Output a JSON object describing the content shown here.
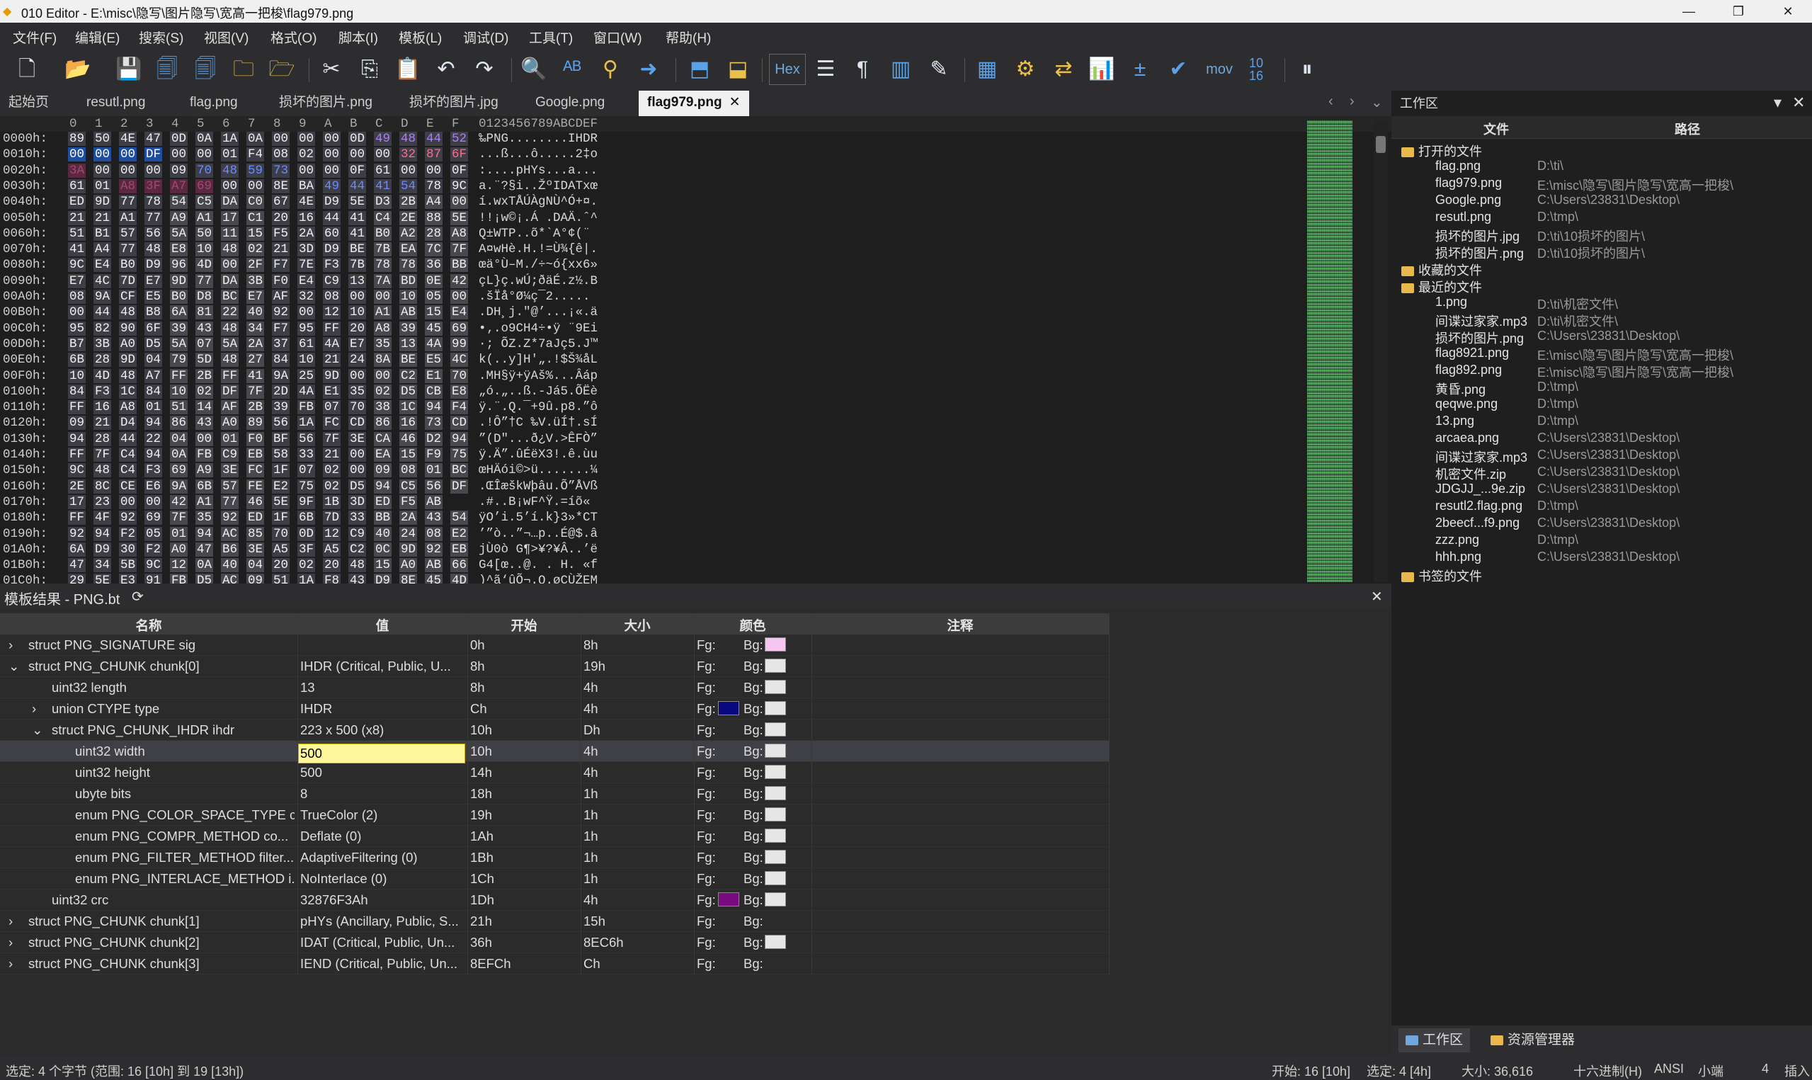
{
  "window": {
    "title": "010 Editor - E:\\misc\\隐写\\图片隐写\\宽高一把梭\\flag979.png"
  },
  "menu": [
    "文件(F)",
    "编辑(E)",
    "搜索(S)",
    "视图(V)",
    "格式(O)",
    "脚本(I)",
    "模板(L)",
    "调试(D)",
    "工具(T)",
    "窗口(W)",
    "帮助(H)"
  ],
  "toolbar": {
    "hex_label": "Hex",
    "mov_label": "mov",
    "num_label": "10 16"
  },
  "tabs": [
    {
      "label": "起始页"
    },
    {
      "label": "resutl.png"
    },
    {
      "label": "flag.png"
    },
    {
      "label": "损坏的图片.png"
    },
    {
      "label": "损坏的图片.jpg"
    },
    {
      "label": "Google.png"
    },
    {
      "label": "flag979.png",
      "active": true
    }
  ],
  "hex": {
    "col_header": [
      "0",
      "1",
      "2",
      "3",
      "4",
      "5",
      "6",
      "7",
      "8",
      "9",
      "A",
      "B",
      "C",
      "D",
      "E",
      "F"
    ],
    "ascii_header": "0123456789ABCDEF",
    "rows": [
      {
        "addr": "0000h:",
        "bytes": [
          "89",
          "50",
          "4E",
          "47",
          "0D",
          "0A",
          "1A",
          "0A",
          "00",
          "00",
          "00",
          "0D",
          "49",
          "48",
          "44",
          "52"
        ],
        "ascii": "‰PNG........IHDR"
      },
      {
        "addr": "0010h:",
        "bytes": [
          "00",
          "00",
          "00",
          "DF",
          "00",
          "00",
          "01",
          "F4",
          "08",
          "02",
          "00",
          "00",
          "00",
          "32",
          "87",
          "6F"
        ],
        "ascii": "...ß...ô.....2‡o"
      },
      {
        "addr": "0020h:",
        "bytes": [
          "3A",
          "00",
          "00",
          "00",
          "09",
          "70",
          "48",
          "59",
          "73",
          "00",
          "00",
          "0F",
          "61",
          "00",
          "00",
          "0F"
        ],
        "ascii": ":....pHYs...a..."
      },
      {
        "addr": "0030h:",
        "bytes": [
          "61",
          "01",
          "A8",
          "3F",
          "A7",
          "69",
          "00",
          "00",
          "8E",
          "BA",
          "49",
          "44",
          "41",
          "54",
          "78",
          "9C"
        ],
        "ascii": "a.¨?§i..ŽºIDATxœ"
      },
      {
        "addr": "0040h:",
        "bytes": [
          "ED",
          "9D",
          "77",
          "78",
          "54",
          "C5",
          "DA",
          "C0",
          "67",
          "4E",
          "D9",
          "5E",
          "D3",
          "2B",
          "A4",
          "00"
        ],
        "ascii": "í.wxTÅÚÀgNÙ^Ó+¤."
      },
      {
        "addr": "0050h:",
        "bytes": [
          "21",
          "21",
          "A1",
          "77",
          "A9",
          "A1",
          "17",
          "C1",
          "20",
          "16",
          "44",
          "41",
          "C4",
          "2E",
          "88",
          "5E"
        ],
        "ascii": "!!¡w©¡.Á .DAÄ.ˆ^"
      },
      {
        "addr": "0060h:",
        "bytes": [
          "51",
          "B1",
          "57",
          "56",
          "5A",
          "50",
          "11",
          "15",
          "F5",
          "2A",
          "60",
          "41",
          "B0",
          "A2",
          "28",
          "A8"
        ],
        "ascii": "Q±WTP..õ*`A°¢(¨"
      },
      {
        "addr": "0070h:",
        "bytes": [
          "41",
          "A4",
          "77",
          "48",
          "E8",
          "10",
          "48",
          "02",
          "21",
          "3D",
          "D9",
          "BE",
          "7B",
          "EA",
          "7C",
          "7F"
        ],
        "ascii": "A¤wHè.H.!=Ù¾{ê|."
      },
      {
        "addr": "0080h:",
        "bytes": [
          "9C",
          "E4",
          "B0",
          "D9",
          "96",
          "4D",
          "00",
          "2F",
          "F7",
          "7E",
          "F3",
          "7B",
          "78",
          "78",
          "36",
          "BB"
        ],
        "ascii": "œä°Ù–M./÷~ó{xx6»"
      },
      {
        "addr": "0090h:",
        "bytes": [
          "E7",
          "4C",
          "7D",
          "E7",
          "9D",
          "77",
          "DA",
          "3B",
          "F0",
          "E4",
          "C9",
          "13",
          "7A",
          "BD",
          "0E",
          "42"
        ],
        "ascii": "çL}ç.wÚ;ðäÉ.z½.B"
      },
      {
        "addr": "00A0h:",
        "bytes": [
          "08",
          "9A",
          "CF",
          "E5",
          "B0",
          "D8",
          "BC",
          "E7",
          "AF",
          "32",
          "08",
          "00",
          "00",
          "10",
          "05",
          "00"
        ],
        "ascii": ".šÏå°Ø¼ç¯2....."
      },
      {
        "addr": "00B0h:",
        "bytes": [
          "00",
          "44",
          "48",
          "B8",
          "6A",
          "81",
          "22",
          "40",
          "92",
          "00",
          "12",
          "10",
          "A1",
          "AB",
          "15",
          "E4"
        ],
        "ascii": ".DH¸j.\"@’...¡«.ä"
      },
      {
        "addr": "00C0h:",
        "bytes": [
          "95",
          "82",
          "90",
          "6F",
          "39",
          "43",
          "48",
          "34",
          "F7",
          "95",
          "FF",
          "20",
          "A8",
          "39",
          "45",
          "69"
        ],
        "ascii": "•‚.o9CH4÷•ÿ ¨9Ei"
      },
      {
        "addr": "00D0h:",
        "bytes": [
          "B7",
          "3B",
          "A0",
          "D5",
          "5A",
          "07",
          "5A",
          "2A",
          "37",
          "61",
          "4A",
          "E7",
          "35",
          "13",
          "4A",
          "99"
        ],
        "ascii": "·; ÕZ.Z*7aJç5.J™"
      },
      {
        "addr": "00E0h:",
        "bytes": [
          "6B",
          "28",
          "9D",
          "04",
          "79",
          "5D",
          "48",
          "27",
          "84",
          "10",
          "21",
          "24",
          "8A",
          "BE",
          "E5",
          "4C"
        ],
        "ascii": "k(..y]H'„.!$Š¾åL"
      },
      {
        "addr": "00F0h:",
        "bytes": [
          "10",
          "4D",
          "48",
          "A7",
          "FF",
          "2B",
          "FF",
          "41",
          "9A",
          "25",
          "9D",
          "00",
          "00",
          "C2",
          "E1",
          "70"
        ],
        "ascii": ".MH§ÿ+ÿAš%...Âáp"
      },
      {
        "addr": "0100h:",
        "bytes": [
          "84",
          "F3",
          "1C",
          "84",
          "10",
          "02",
          "DF",
          "7F",
          "2D",
          "4A",
          "E1",
          "35",
          "02",
          "D5",
          "CB",
          "E8"
        ],
        "ascii": "„ó.„..ß.-Já5.ÕËè"
      },
      {
        "addr": "0110h:",
        "bytes": [
          "FF",
          "16",
          "A8",
          "01",
          "51",
          "14",
          "AF",
          "2B",
          "39",
          "FB",
          "07",
          "70",
          "38",
          "1C",
          "94",
          "F4"
        ],
        "ascii": "ÿ.¨.Q.¯+9û.p8.”ô"
      },
      {
        "addr": "0120h:",
        "bytes": [
          "09",
          "21",
          "D4",
          "94",
          "86",
          "43",
          "A0",
          "89",
          "56",
          "1A",
          "FC",
          "CD",
          "86",
          "16",
          "73",
          "CD"
        ],
        "ascii": ".!Ô”†C ‰V.üÍ†.sÍ"
      },
      {
        "addr": "0130h:",
        "bytes": [
          "94",
          "28",
          "44",
          "22",
          "04",
          "00",
          "01",
          "F0",
          "BF",
          "56",
          "7F",
          "3E",
          "CA",
          "46",
          "D2",
          "94"
        ],
        "ascii": "”(D\"...ð¿V.>ÊFÒ”"
      },
      {
        "addr": "0140h:",
        "bytes": [
          "FF",
          "7F",
          "C4",
          "94",
          "0A",
          "FB",
          "C9",
          "EB",
          "58",
          "33",
          "21",
          "00",
          "EA",
          "15",
          "F9",
          "75"
        ],
        "ascii": "ÿ.Ä”.ûÉëX3!.ê.ùu"
      },
      {
        "addr": "0150h:",
        "bytes": [
          "9C",
          "48",
          "C4",
          "F3",
          "69",
          "A9",
          "3E",
          "FC",
          "1F",
          "07",
          "02",
          "00",
          "09",
          "08",
          "01",
          "BC"
        ],
        "ascii": "œHÄói©>ü.......¼"
      },
      {
        "addr": "0160h:",
        "bytes": [
          "2E",
          "8C",
          "CE",
          "E6",
          "9A",
          "6B",
          "57",
          "FE",
          "E2",
          "75",
          "02",
          "D5",
          "94",
          "C5",
          "56",
          "DF"
        ],
        "ascii": ".ŒÎæškWþâu.Õ”ÅVß"
      },
      {
        "addr": "0170h:",
        "bytes": [
          "17",
          "23",
          "00",
          "00",
          "42",
          "A1",
          "77",
          "46",
          "5E",
          "9F",
          "1B",
          "3D",
          "ED",
          "F5",
          "AB"
        ],
        "ascii": ".#..B¡wF^Ÿ.=íõ«"
      },
      {
        "addr": "0180h:",
        "bytes": [
          "FF",
          "4F",
          "92",
          "69",
          "7F",
          "35",
          "92",
          "ED",
          "1F",
          "6B",
          "7D",
          "33",
          "BB",
          "2A",
          "43",
          "54"
        ],
        "ascii": "ÿO’i.5’í.k}3»*CT"
      },
      {
        "addr": "0190h:",
        "bytes": [
          "92",
          "94",
          "F2",
          "05",
          "01",
          "94",
          "AC",
          "85",
          "70",
          "0D",
          "12",
          "C9",
          "40",
          "24",
          "08",
          "E2"
        ],
        "ascii": "’”ò..”¬…p..É@$.â"
      },
      {
        "addr": "01A0h:",
        "bytes": [
          "6A",
          "D9",
          "30",
          "F2",
          "A0",
          "47",
          "B6",
          "3E",
          "A5",
          "3F",
          "A5",
          "C2",
          "0C",
          "9D",
          "92",
          "EB"
        ],
        "ascii": "jÙ0ò G¶>¥?¥Â..’ë"
      },
      {
        "addr": "01B0h:",
        "bytes": [
          "47",
          "34",
          "5B",
          "9C",
          "12",
          "0A",
          "40",
          "04",
          "20",
          "02",
          "20",
          "48",
          "15",
          "A0",
          "AB",
          "66"
        ],
        "ascii": "G4[œ..@. . H. «f"
      },
      {
        "addr": "01C0h:",
        "bytes": [
          "29",
          "5E",
          "E3",
          "91",
          "FB",
          "D5",
          "AC",
          "09",
          "51",
          "1A",
          "F8",
          "43",
          "D9",
          "8E",
          "45",
          "4D"
        ],
        "ascii": ")^ã‘ûÕ¬.Q.øCÙŽEM"
      }
    ]
  },
  "workspace": {
    "title": "工作区",
    "col_file": "文件",
    "col_path": "路径",
    "sections": {
      "open": "打开的文件",
      "fav": "收藏的文件",
      "recent": "最近的文件",
      "bookmark": "书签的文件"
    },
    "open_files": [
      {
        "name": "flag.png",
        "path": "D:\\ti\\"
      },
      {
        "name": "flag979.png",
        "path": "E:\\misc\\隐写\\图片隐写\\宽高一把梭\\"
      },
      {
        "name": "Google.png",
        "path": "C:\\Users\\23831\\Desktop\\"
      },
      {
        "name": "resutl.png",
        "path": "D:\\tmp\\"
      },
      {
        "name": "损坏的图片.jpg",
        "path": "D:\\ti\\10损坏的图片\\"
      },
      {
        "name": "损坏的图片.png",
        "path": "D:\\ti\\10损坏的图片\\"
      }
    ],
    "recent_files": [
      {
        "name": "1.png",
        "path": "D:\\ti\\机密文件\\"
      },
      {
        "name": "间谍过家家.mp3",
        "path": "D:\\ti\\机密文件\\"
      },
      {
        "name": "损坏的图片.png",
        "path": "C:\\Users\\23831\\Desktop\\"
      },
      {
        "name": "flag8921.png",
        "path": "E:\\misc\\隐写\\图片隐写\\宽高一把梭\\"
      },
      {
        "name": "flag892.png",
        "path": "E:\\misc\\隐写\\图片隐写\\宽高一把梭\\"
      },
      {
        "name": "黄昏.png",
        "path": "D:\\tmp\\"
      },
      {
        "name": "qeqwe.png",
        "path": "D:\\tmp\\"
      },
      {
        "name": "13.png",
        "path": "D:\\tmp\\"
      },
      {
        "name": "arcaea.png",
        "path": "C:\\Users\\23831\\Desktop\\"
      },
      {
        "name": "间谍过家家.mp3",
        "path": "C:\\Users\\23831\\Desktop\\"
      },
      {
        "name": "机密文件.zip",
        "path": "C:\\Users\\23831\\Desktop\\"
      },
      {
        "name": "JDGJJ_...9e.zip",
        "path": "C:\\Users\\23831\\Desktop\\"
      },
      {
        "name": "resutl2.flag.png",
        "path": "D:\\tmp\\"
      },
      {
        "name": "2beecf...f9.png",
        "path": "C:\\Users\\23831\\Desktop\\"
      },
      {
        "name": "zzz.png",
        "path": "D:\\tmp\\"
      },
      {
        "name": "hhh.png",
        "path": "C:\\Users\\23831\\Desktop\\"
      }
    ]
  },
  "template": {
    "title": "模板结果 - PNG.bt",
    "headers": {
      "name": "名称",
      "value": "值",
      "start": "开始",
      "size": "大小",
      "color": "颜色",
      "comment": "注释"
    },
    "fg": "Fg:",
    "bg": "Bg:",
    "rows": [
      {
        "indent": 0,
        "exp": "›",
        "name": "struct PNG_SIGNATURE sig",
        "value": "",
        "start": "0h",
        "size": "8h",
        "fg": "",
        "bg": "#f5c6f0"
      },
      {
        "indent": 0,
        "exp": "⌄",
        "name": "struct PNG_CHUNK chunk[0]",
        "value": "IHDR  (Critical, Public, U...",
        "start": "8h",
        "size": "19h",
        "fg": "",
        "bg": "#e6e6e6"
      },
      {
        "indent": 1,
        "exp": "",
        "name": "uint32 length",
        "value": "13",
        "start": "8h",
        "size": "4h",
        "fg": "",
        "bg": "#e6e6e6"
      },
      {
        "indent": 1,
        "exp": "›",
        "name": "union CTYPE type",
        "value": "IHDR",
        "start": "Ch",
        "size": "4h",
        "fg": "#0a0a80",
        "bg": "#e6e6e6"
      },
      {
        "indent": 1,
        "exp": "⌄",
        "name": "struct PNG_CHUNK_IHDR ihdr",
        "value": "223 x 500 (x8)",
        "start": "10h",
        "size": "Dh",
        "fg": "",
        "bg": "#e6e6e6"
      },
      {
        "indent": 2,
        "exp": "",
        "name": "uint32 width",
        "value": "500",
        "start": "10h",
        "size": "4h",
        "fg": "",
        "bg": "#e6e6e6",
        "editing": true
      },
      {
        "indent": 2,
        "exp": "",
        "name": "uint32 height",
        "value": "500",
        "start": "14h",
        "size": "4h",
        "fg": "",
        "bg": "#e6e6e6"
      },
      {
        "indent": 2,
        "exp": "",
        "name": "ubyte bits",
        "value": "8",
        "start": "18h",
        "size": "1h",
        "fg": "",
        "bg": "#e6e6e6"
      },
      {
        "indent": 2,
        "exp": "",
        "name": "enum PNG_COLOR_SPACE_TYPE c...",
        "value": "TrueColor (2)",
        "start": "19h",
        "size": "1h",
        "fg": "",
        "bg": "#e6e6e6"
      },
      {
        "indent": 2,
        "exp": "",
        "name": "enum PNG_COMPR_METHOD co...",
        "value": "Deflate (0)",
        "start": "1Ah",
        "size": "1h",
        "fg": "",
        "bg": "#e6e6e6"
      },
      {
        "indent": 2,
        "exp": "",
        "name": "enum PNG_FILTER_METHOD filter...",
        "value": "AdaptiveFiltering (0)",
        "start": "1Bh",
        "size": "1h",
        "fg": "",
        "bg": "#e6e6e6"
      },
      {
        "indent": 2,
        "exp": "",
        "name": "enum PNG_INTERLACE_METHOD i...",
        "value": "NoInterlace (0)",
        "start": "1Ch",
        "size": "1h",
        "fg": "",
        "bg": "#e6e6e6"
      },
      {
        "indent": 1,
        "exp": "",
        "name": "uint32 crc",
        "value": "32876F3Ah",
        "start": "1Dh",
        "size": "4h",
        "fg": "#7a0a80",
        "bg": "#e6e6e6"
      },
      {
        "indent": 0,
        "exp": "›",
        "name": "struct PNG_CHUNK chunk[1]",
        "value": "pHYs  (Ancillary, Public, S...",
        "start": "21h",
        "size": "15h",
        "fg": "",
        "bg": ""
      },
      {
        "indent": 0,
        "exp": "›",
        "name": "struct PNG_CHUNK chunk[2]",
        "value": "IDAT  (Critical, Public, Un...",
        "start": "36h",
        "size": "8EC6h",
        "fg": "",
        "bg": "#e6e6e6"
      },
      {
        "indent": 0,
        "exp": "›",
        "name": "struct PNG_CHUNK chunk[3]",
        "value": "IEND  (Critical, Public, Un...",
        "start": "8EFCh",
        "size": "Ch",
        "fg": "",
        "bg": ""
      }
    ]
  },
  "bottom_tabs": [
    {
      "label": "工作区"
    },
    {
      "label": "资源管理器"
    }
  ],
  "status": {
    "left": "选定: 4 个字节 (范围: 16 [10h] 到 19 [13h])",
    "start": "开始: 16 [10h]",
    "sel": "选定: 4 [4h]",
    "size": "大小: 36,616",
    "mode": "十六进制(H)",
    "enc": "ANSI",
    "endian": "小端",
    "col": "4",
    "ins": "插入"
  }
}
